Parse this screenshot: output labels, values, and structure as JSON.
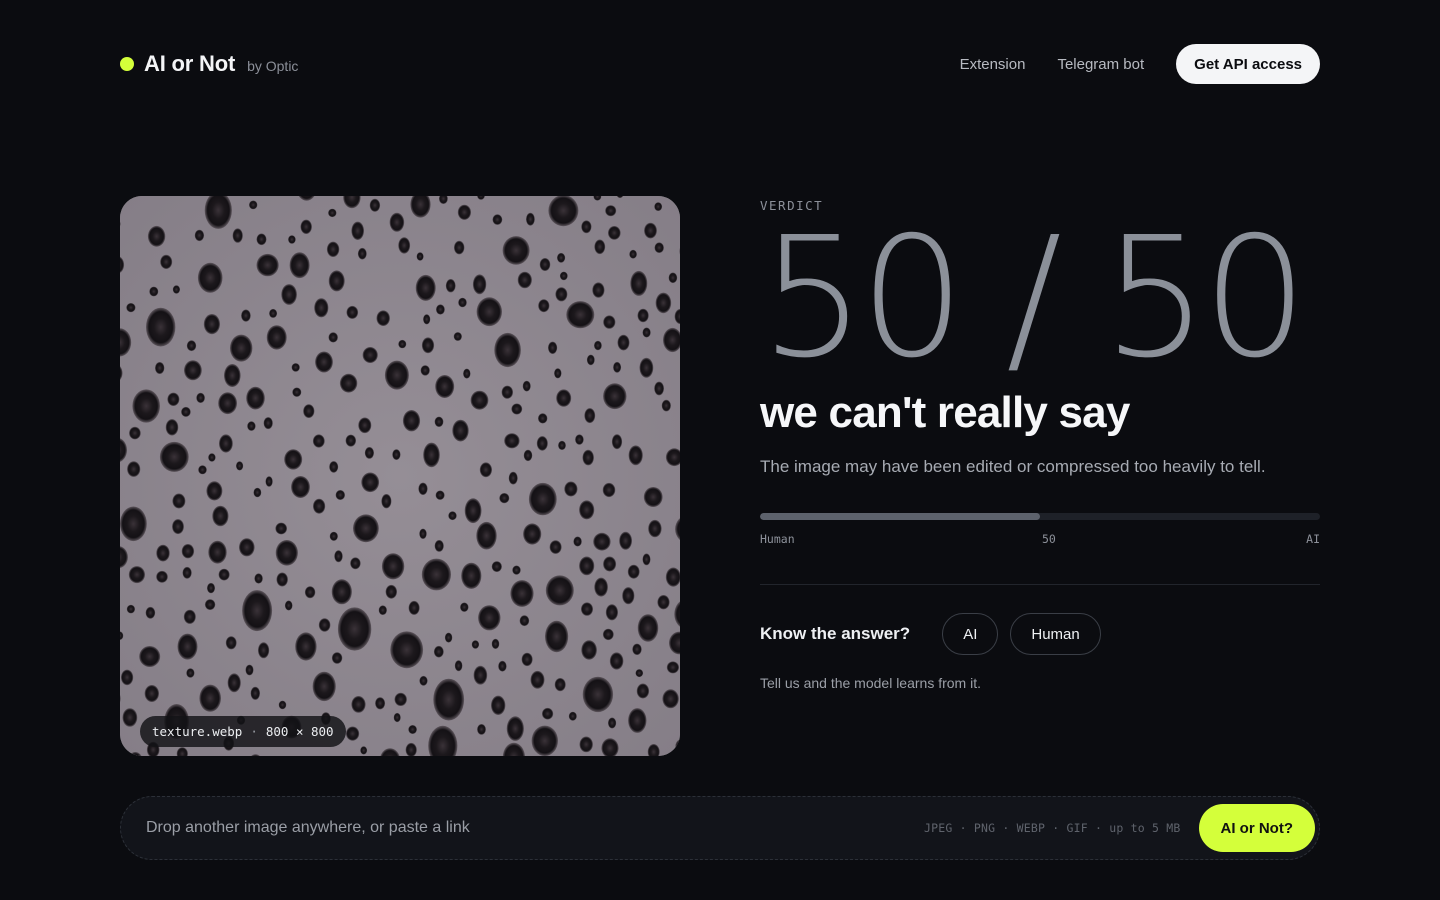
{
  "brand": {
    "name": "AI or Not",
    "sub": "by Optic",
    "accent": "#d4ff3a"
  },
  "nav": {
    "links": [
      "Extension",
      "Telegram bot"
    ],
    "api_button": "Get API access"
  },
  "image": {
    "filename": "texture.webp",
    "separator": "·",
    "dimensions": "800 × 800"
  },
  "verdict": {
    "label": "VERDICT",
    "score": "50 / 50",
    "tagline": "we can't really say",
    "description": "The image may have been edited or compressed too heavily to tell.",
    "meter": {
      "value": 50,
      "max": 100,
      "left_label": "Human",
      "mid_label": "50",
      "right_label": "AI"
    }
  },
  "feedback": {
    "question": "Know the answer?",
    "options": [
      "AI",
      "Human"
    ],
    "note": "Tell us and the model learns from it."
  },
  "dropbar": {
    "placeholder": "Drop another image anywhere, or paste a link",
    "formats": "JPEG · PNG · WEBP · GIF · up to 5 MB",
    "submit": "AI or Not?"
  }
}
